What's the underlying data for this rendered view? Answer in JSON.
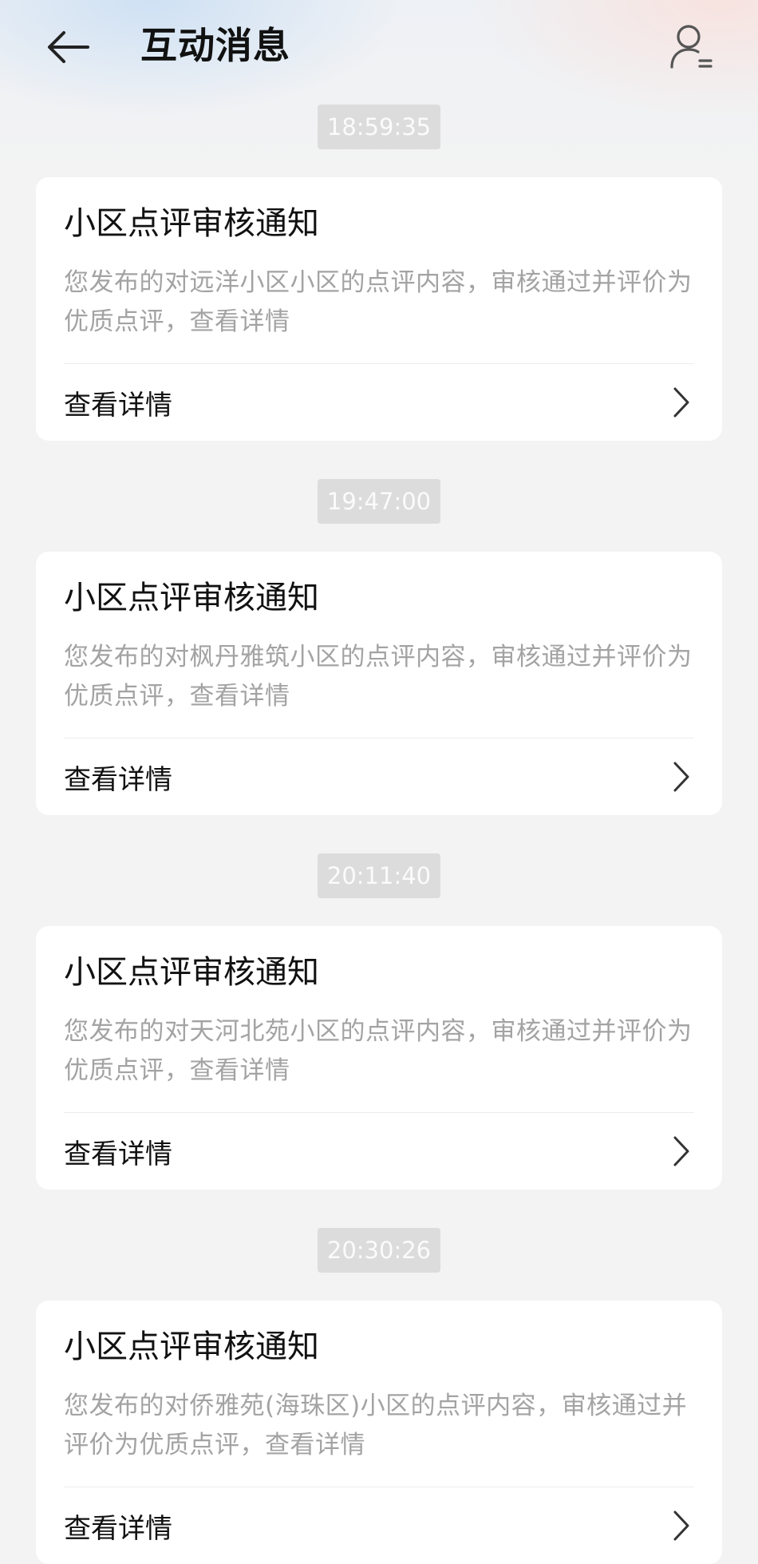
{
  "header": {
    "title": "互动消息",
    "back_icon": "back-arrow-icon",
    "user_icon": "user-list-icon"
  },
  "messages": [
    {
      "time": "18:59:35",
      "title": "小区点评审核通知",
      "body": "您发布的对远洋小区小区的点评内容，审核通过并评价为优质点评，查看详情",
      "action": "查看详情"
    },
    {
      "time": "19:47:00",
      "title": "小区点评审核通知",
      "body": "您发布的对枫丹雅筑小区的点评内容，审核通过并评价为优质点评，查看详情",
      "action": "查看详情"
    },
    {
      "time": "20:11:40",
      "title": "小区点评审核通知",
      "body": "您发布的对天河北苑小区的点评内容，审核通过并评价为优质点评，查看详情",
      "action": "查看详情"
    },
    {
      "time": "20:30:26",
      "title": "小区点评审核通知",
      "body": "您发布的对侨雅苑(海珠区)小区的点评内容，审核通过并评价为优质点评，查看详情",
      "action": "查看详情"
    }
  ],
  "colors": {
    "background": "#f3f3f3",
    "card": "#ffffff",
    "timestamp_bg": "#dcdcdc",
    "body_text": "#a3a3a3"
  }
}
